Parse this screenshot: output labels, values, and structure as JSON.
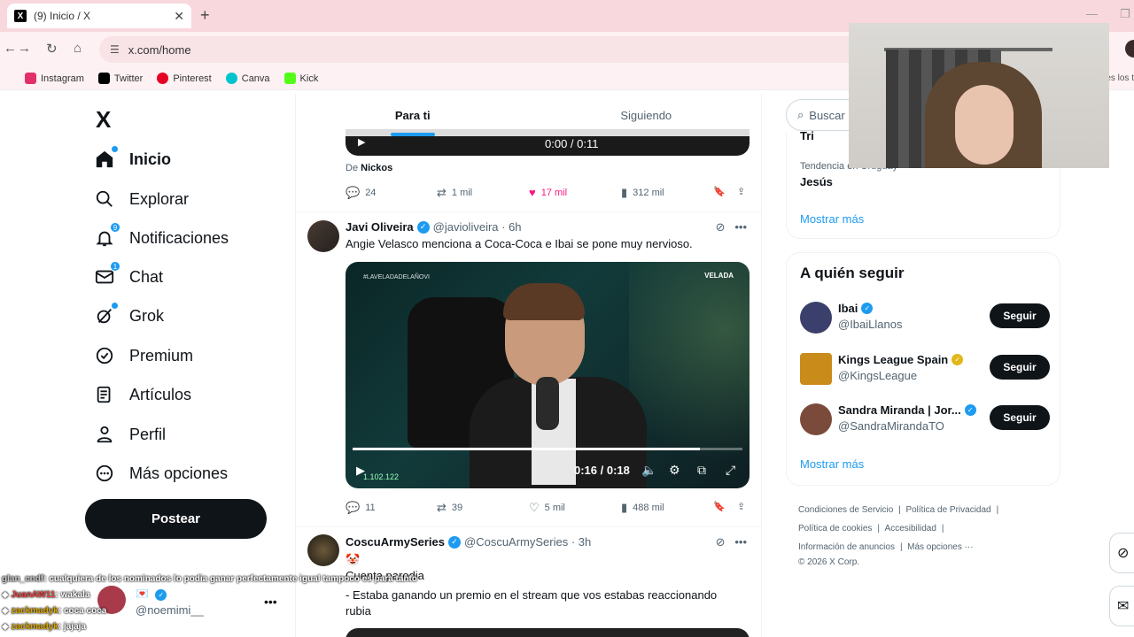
{
  "browser": {
    "tab_title": "(9) Inicio / X",
    "url": "x.com/home",
    "bookmarks": [
      {
        "label": "Instagram",
        "color": "#e1306c"
      },
      {
        "label": "Twitter",
        "color": "#000000"
      },
      {
        "label": "Pinterest",
        "color": "#e60023"
      },
      {
        "label": "Canva",
        "color": "#00c4cc"
      },
      {
        "label": "Kick",
        "color": "#53fc18"
      }
    ],
    "bookmarks_overflow": "es los t"
  },
  "sidebar": {
    "logo": "X",
    "items": [
      {
        "label": "Inicio",
        "icon": "home-icon"
      },
      {
        "label": "Explorar",
        "icon": "search-icon"
      },
      {
        "label": "Notificaciones",
        "icon": "bell-icon",
        "badge": "9"
      },
      {
        "label": "Chat",
        "icon": "mail-icon",
        "badge": "1"
      },
      {
        "label": "Grok",
        "icon": "grok-icon"
      },
      {
        "label": "Premium",
        "icon": "premium-icon"
      },
      {
        "label": "Artículos",
        "icon": "articles-icon"
      },
      {
        "label": "Perfil",
        "icon": "person-icon"
      },
      {
        "label": "Más opciones",
        "icon": "more-circle-icon"
      }
    ],
    "post_label": "Postear",
    "account": {
      "display": "💌",
      "handle": "@noemimi__"
    }
  },
  "stream_chat": [
    {
      "user": "glan_cndf",
      "text": ": cualquiera de los nominados lo podia ganar perfectamente igual tampoco es para tanto"
    },
    {
      "user": "JuanAW11",
      "text": ": wakala"
    },
    {
      "user": "zackmadyk",
      "text": ": coca coca"
    },
    {
      "user": "zackmadyk",
      "text": ": jajaja"
    }
  ],
  "feed": {
    "tabs": [
      "Para ti",
      "Siguiendo"
    ],
    "prev_video_time": "0:00 / 0:11",
    "prev_from_prefix": "De",
    "prev_from_name": "Nickos",
    "prev_actions": {
      "replies": "24",
      "reposts": "1 mil",
      "likes": "17 mil",
      "views": "312 mil"
    },
    "tweet1": {
      "name": "Javi Oliveira",
      "meta": "@javioliveira · 6h",
      "text": "Angie Velasco menciona a Coca-Coca e Ibai se pone muy nervioso.",
      "video_watermark": "#LAVELADADELAÑOVI",
      "video_logo": "VELADA",
      "video_time": "0:16 / 0:18",
      "video_progress": 0.89,
      "video_corner": "1.102.122",
      "actions": {
        "replies": "11",
        "reposts": "39",
        "likes": "5 mil",
        "views": "488 mil"
      }
    },
    "tweet2": {
      "name": "CoscuArmySeries",
      "meta": "@CoscuArmySeries · 3h",
      "line1": "🤡",
      "line2": "Cuenta parodia",
      "line3": "- Estaba ganando un premio en el stream que vos estabas reaccionando",
      "line4": "rubia"
    }
  },
  "right": {
    "search_placeholder": "Buscar",
    "trend_top": "Tri",
    "trend_context": "Tendencia en Uruguay",
    "trend_name": "Jesús",
    "show_more": "Mostrar más",
    "who_title": "A quién seguir",
    "who": [
      {
        "name": "Ibai",
        "handle": "@IbaiLlanos",
        "badge_color": "#1d9bf0",
        "avatar": "#3b3f6b"
      },
      {
        "name": "Kings League Spain",
        "handle": "@KingsLeague",
        "badge_color": "#e2b719",
        "avatar": "#c98b1a"
      },
      {
        "name": "Sandra Miranda | Jor...",
        "handle": "@SandraMirandaTO",
        "badge_color": "#1d9bf0",
        "avatar": "#7a4a3a"
      }
    ],
    "follow_label": "Seguir",
    "footer": {
      "l1a": "Condiciones de Servicio",
      "l1b": "Política de Privacidad",
      "l2a": "Política de cookies",
      "l2b": "Accesibilidad",
      "l3a": "Información de anuncios",
      "l3b": "Más opciones ···",
      "copy": "© 2026 X Corp."
    }
  }
}
